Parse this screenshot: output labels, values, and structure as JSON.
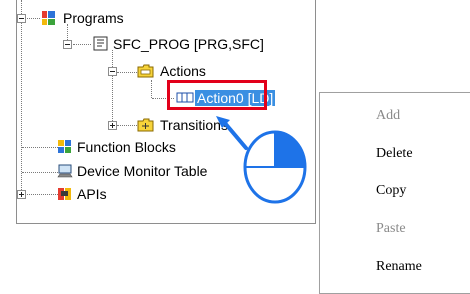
{
  "tree": {
    "items": [
      {
        "label": "Programs",
        "icon": "programs-folder-icon"
      },
      {
        "label": "SFC_PROG [PRG,SFC]",
        "icon": "sfc-program-icon"
      },
      {
        "label": "Actions",
        "icon": "folder-icon"
      },
      {
        "label": "Action0 [LD]",
        "icon": "action-icon",
        "selected": true
      },
      {
        "label": "Transitions",
        "icon": "folder-icon"
      },
      {
        "label": "Function Blocks",
        "icon": "function-blocks-icon"
      },
      {
        "label": "Device Monitor Table",
        "icon": "monitor-icon"
      },
      {
        "label": "APIs",
        "icon": "apis-icon"
      }
    ]
  },
  "context_menu": {
    "items": [
      {
        "label": "Add",
        "enabled": false
      },
      {
        "label": "Delete",
        "enabled": true
      },
      {
        "label": "Copy",
        "enabled": true
      },
      {
        "label": "Paste",
        "enabled": false
      },
      {
        "label": "Rename",
        "enabled": true
      }
    ]
  },
  "colors": {
    "highlight": "#e2001a",
    "selection": "#3a8fe2",
    "mouse_accent": "#1e73e8"
  },
  "annotation": {
    "icon": "right-mouse-button-icon"
  }
}
